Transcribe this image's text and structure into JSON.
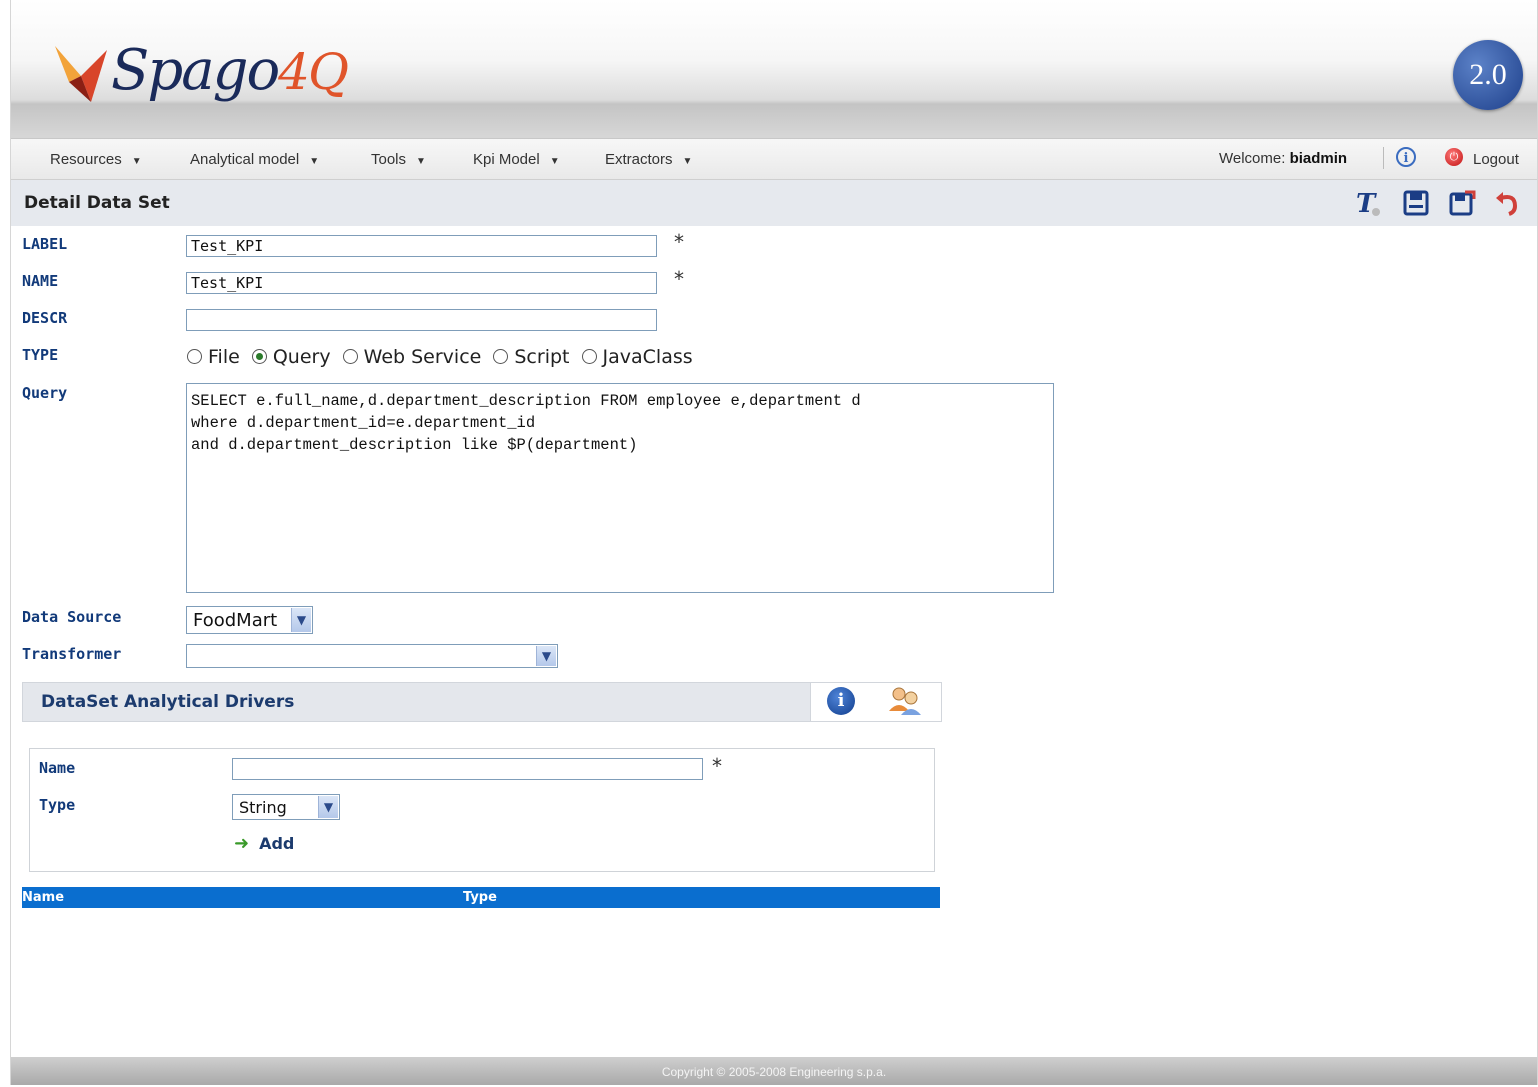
{
  "header": {
    "logo_text": "Spago",
    "logo_accent": "4Q",
    "version": "2.0"
  },
  "menu": {
    "items": [
      {
        "label": "Resources"
      },
      {
        "label": "Analytical model"
      },
      {
        "label": "Tools"
      },
      {
        "label": "Kpi Model"
      },
      {
        "label": "Extractors"
      }
    ],
    "welcome_prefix": "Welcome:",
    "username": "biadmin",
    "logout": "Logout"
  },
  "page": {
    "title": "Detail Data Set"
  },
  "form": {
    "label": {
      "caption": "LABEL",
      "value": "Test_KPI",
      "required": "*"
    },
    "name": {
      "caption": "NAME",
      "value": "Test_KPI",
      "required": "*"
    },
    "descr": {
      "caption": "DESCR",
      "value": ""
    },
    "type": {
      "caption": "TYPE",
      "options": [
        "File",
        "Query",
        "Web Service",
        "Script",
        "JavaClass"
      ],
      "selected": "Query"
    },
    "query": {
      "caption": "Query",
      "value": "SELECT e.full_name,d.department_description FROM employee e,department d\nwhere d.department_id=e.department_id\nand d.department_description like $P(department)"
    },
    "data_source": {
      "caption": "Data Source",
      "value": "FoodMart"
    },
    "transformer": {
      "caption": "Transformer",
      "value": ""
    }
  },
  "drivers": {
    "title": "DataSet Analytical Drivers",
    "name_caption": "Name",
    "name_value": "",
    "name_required": "*",
    "type_caption": "Type",
    "type_value": "String",
    "add_label": "Add",
    "table_columns": [
      "Name",
      "Type"
    ]
  },
  "footer": {
    "copyright": "Copyright © 2005-2008 Engineering s.p.a."
  },
  "colors": {
    "label_blue": "#123a7a",
    "table_header": "#0a6ecf",
    "accent_orange": "#e0542a"
  }
}
